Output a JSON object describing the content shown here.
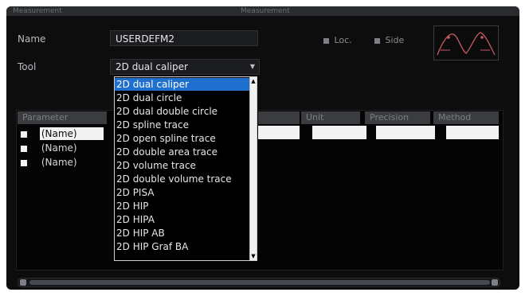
{
  "window": {
    "header_left": "Measurement",
    "header_title": "Measurement"
  },
  "form": {
    "name_label": "Name",
    "name_value": "USERDEFM2",
    "tool_label": "Tool",
    "tool_value": "2D dual caliper",
    "loc_label": "Loc.",
    "side_label": "Side"
  },
  "table": {
    "headers": [
      "Parameter",
      "Unit",
      "Precision",
      "Method"
    ],
    "rows": [
      "(Name)",
      "(Name)",
      "(Name)"
    ]
  },
  "dropdown": {
    "options": [
      "2D dual caliper",
      "2D dual circle",
      "2D dual double circle",
      "2D spline trace",
      "2D open spline trace",
      "2D double area trace",
      "2D volume trace",
      "2D double volume trace",
      "2D PISA",
      "2D HIP",
      "2D HIPA",
      "2D HIP AB",
      "2D HIP Graf BA"
    ],
    "selected_index": 0
  },
  "colors": {
    "background": "#0d0d0e",
    "selection": "#1f6fcf",
    "thumbnail_curve": "#c85a63"
  }
}
